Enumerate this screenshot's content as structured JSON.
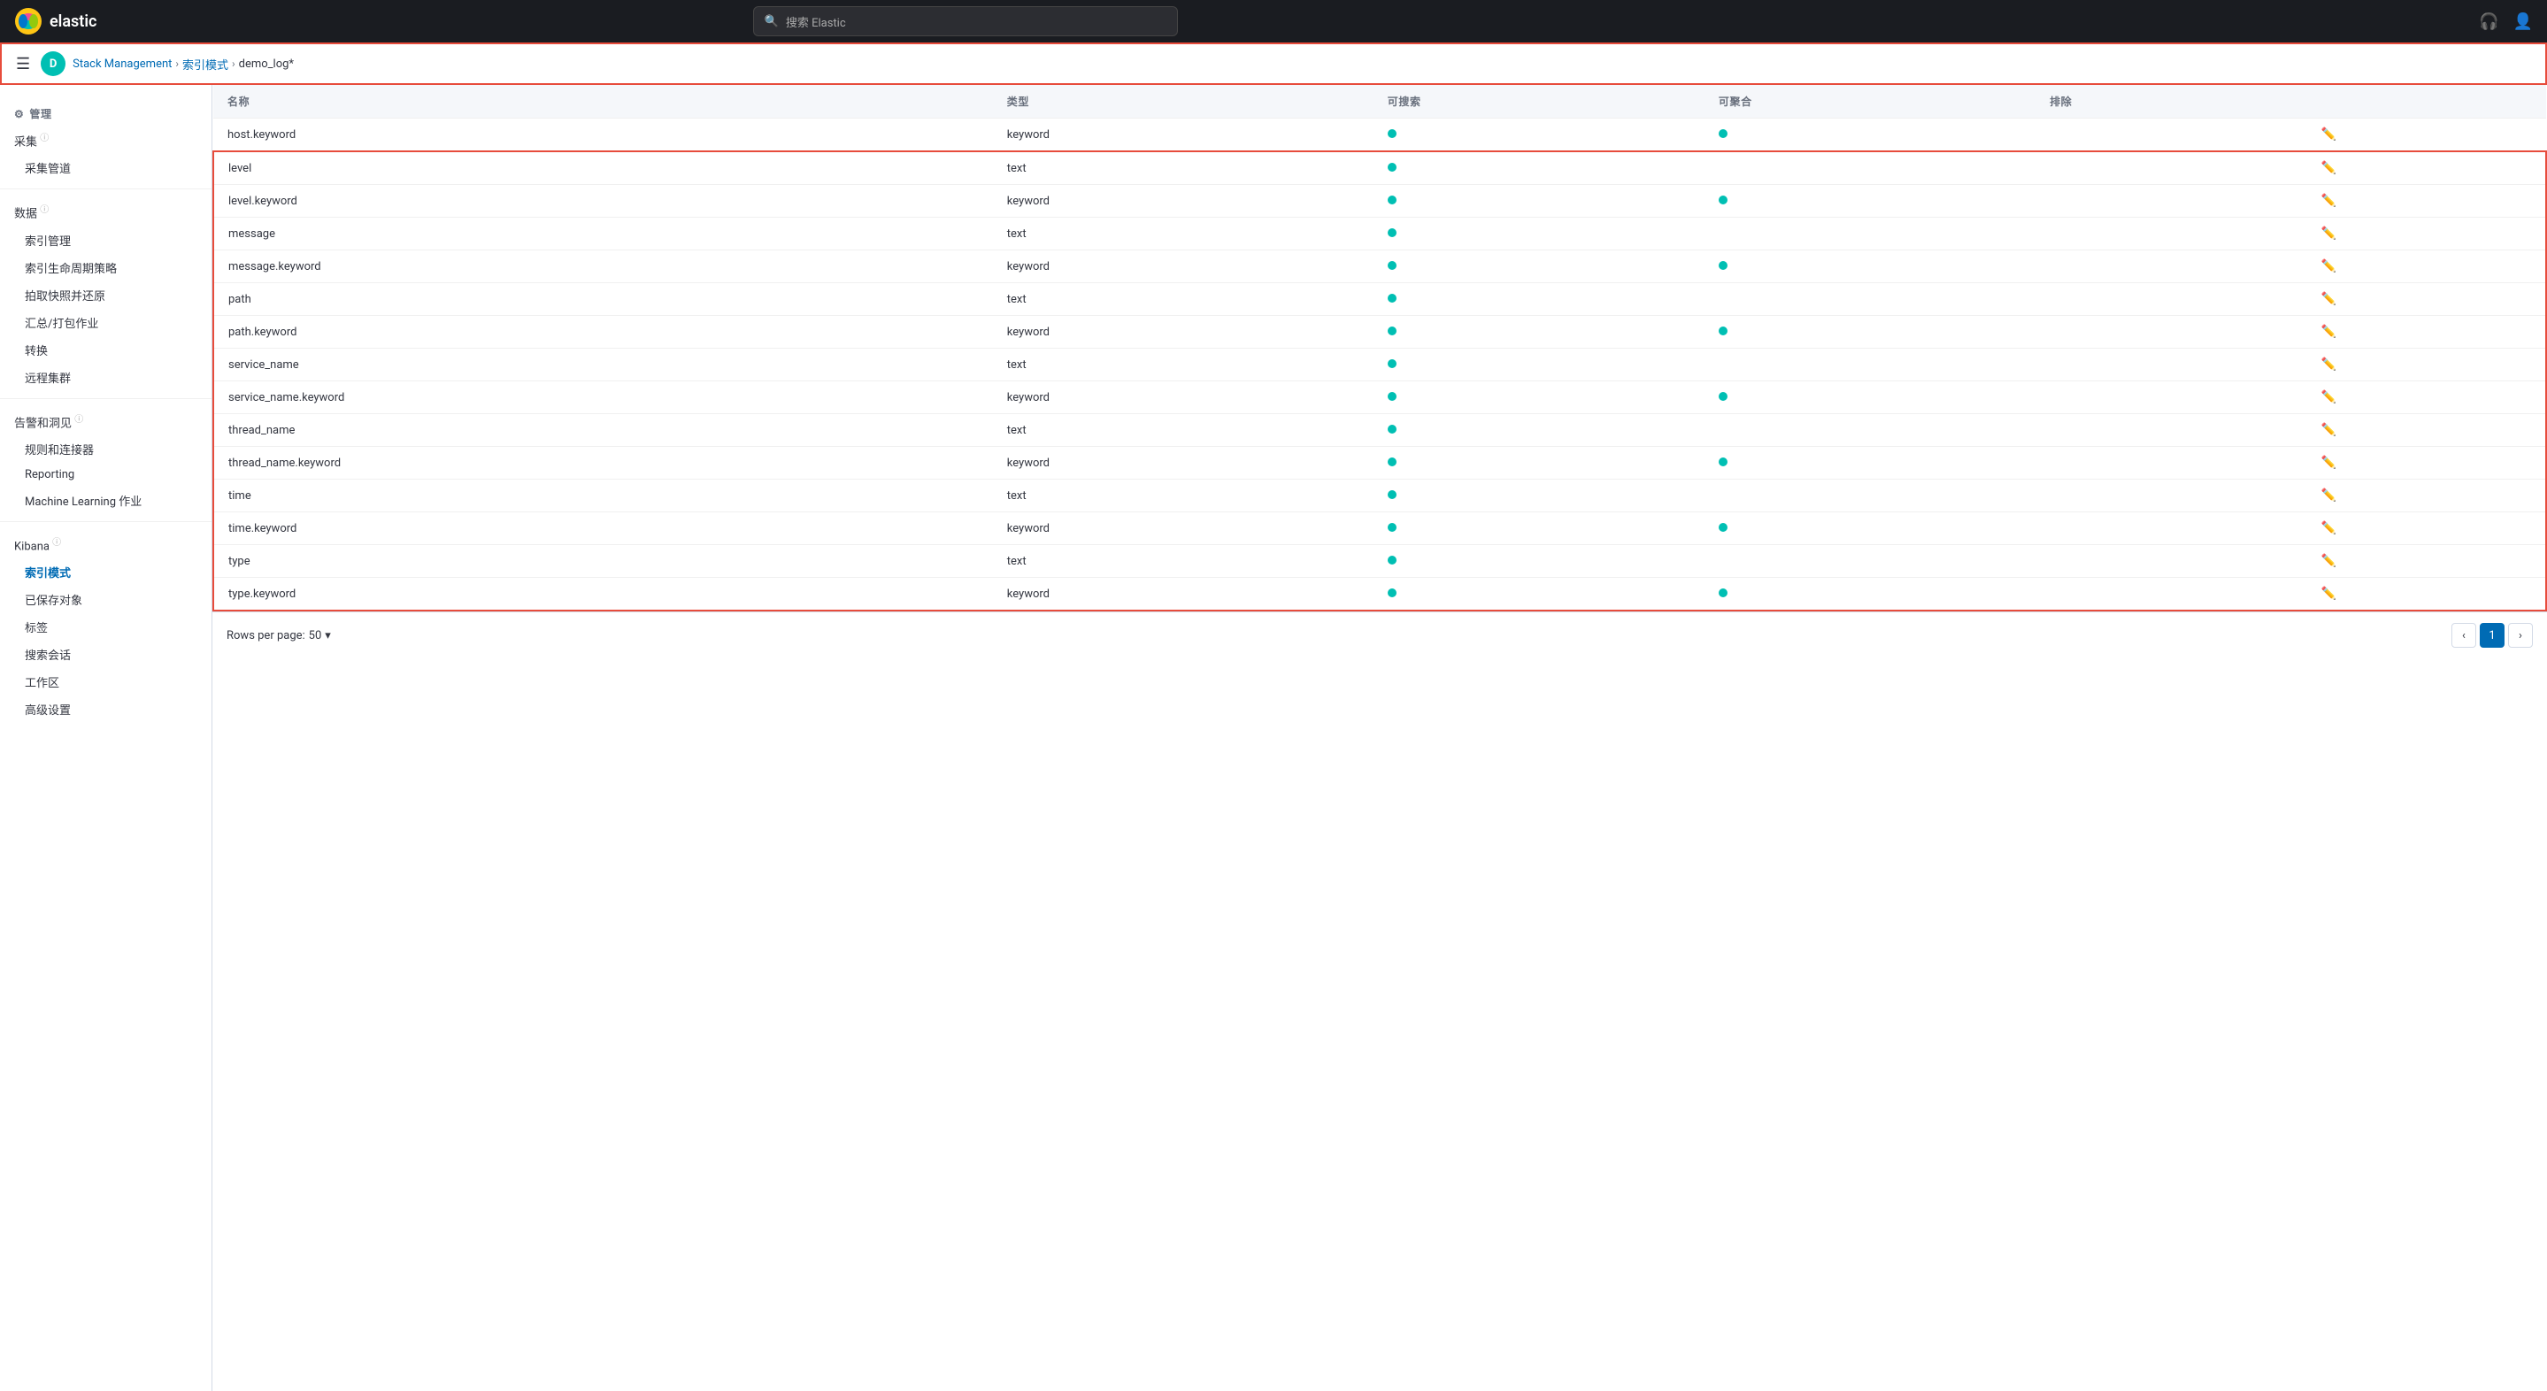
{
  "topNav": {
    "logoText": "elastic",
    "searchPlaceholder": "搜索 Elastic",
    "rightIcons": [
      "headset-icon",
      "user-icon"
    ]
  },
  "breadcrumb": {
    "badge": "D",
    "items": [
      {
        "label": "Stack Management",
        "active": false
      },
      {
        "label": "索引模式",
        "active": false
      },
      {
        "label": "demo_log*",
        "active": true
      }
    ]
  },
  "sidebar": {
    "managementLabel": "管理",
    "sections": [
      {
        "title": "采集",
        "hasInfo": true,
        "items": [
          "采集管道"
        ]
      },
      {
        "title": "数据",
        "hasInfo": true,
        "items": [
          "索引管理",
          "索引生命周期策略",
          "拍取快照并还原",
          "汇总/打包作业",
          "转换",
          "远程集群"
        ]
      },
      {
        "title": "告警和洞见",
        "hasInfo": true,
        "items": [
          "规则和连接器",
          "Reporting",
          "Machine Learning 作业"
        ]
      },
      {
        "title": "Kibana",
        "hasInfo": true,
        "items": [
          "索引模式",
          "已保存对象",
          "标签",
          "搜索会话",
          "工作区",
          "高级设置"
        ]
      }
    ],
    "activeItem": "索引模式"
  },
  "table": {
    "columns": [
      "名称",
      "类型",
      "可搜索",
      "可聚合",
      "排除"
    ],
    "rows": [
      {
        "name": "host.keyword",
        "type": "keyword",
        "searchable": true,
        "aggregatable": true,
        "excluded": false,
        "selected": false
      },
      {
        "name": "level",
        "type": "text",
        "searchable": true,
        "aggregatable": false,
        "excluded": false,
        "selected": true
      },
      {
        "name": "level.keyword",
        "type": "keyword",
        "searchable": true,
        "aggregatable": true,
        "excluded": false,
        "selected": true
      },
      {
        "name": "message",
        "type": "text",
        "searchable": true,
        "aggregatable": false,
        "excluded": false,
        "selected": true
      },
      {
        "name": "message.keyword",
        "type": "keyword",
        "searchable": true,
        "aggregatable": true,
        "excluded": false,
        "selected": true
      },
      {
        "name": "path",
        "type": "text",
        "searchable": true,
        "aggregatable": false,
        "excluded": false,
        "selected": true
      },
      {
        "name": "path.keyword",
        "type": "keyword",
        "searchable": true,
        "aggregatable": true,
        "excluded": false,
        "selected": true
      },
      {
        "name": "service_name",
        "type": "text",
        "searchable": true,
        "aggregatable": false,
        "excluded": false,
        "selected": true
      },
      {
        "name": "service_name.keyword",
        "type": "keyword",
        "searchable": true,
        "aggregatable": true,
        "excluded": false,
        "selected": true
      },
      {
        "name": "thread_name",
        "type": "text",
        "searchable": true,
        "aggregatable": false,
        "excluded": false,
        "selected": true
      },
      {
        "name": "thread_name.keyword",
        "type": "keyword",
        "searchable": true,
        "aggregatable": true,
        "excluded": false,
        "selected": true
      },
      {
        "name": "time",
        "type": "text",
        "searchable": true,
        "aggregatable": false,
        "excluded": false,
        "selected": true
      },
      {
        "name": "time.keyword",
        "type": "keyword",
        "searchable": true,
        "aggregatable": true,
        "excluded": false,
        "selected": true
      },
      {
        "name": "type",
        "type": "text",
        "searchable": true,
        "aggregatable": false,
        "excluded": false,
        "selected": true
      },
      {
        "name": "type.keyword",
        "type": "keyword",
        "searchable": true,
        "aggregatable": true,
        "excluded": false,
        "selected": true
      }
    ]
  },
  "pagination": {
    "rowsPerPageLabel": "Rows per page:",
    "rowsPerPage": "50",
    "currentPage": 1,
    "totalPages": 1,
    "prevLabel": "‹",
    "nextLabel": "›"
  }
}
